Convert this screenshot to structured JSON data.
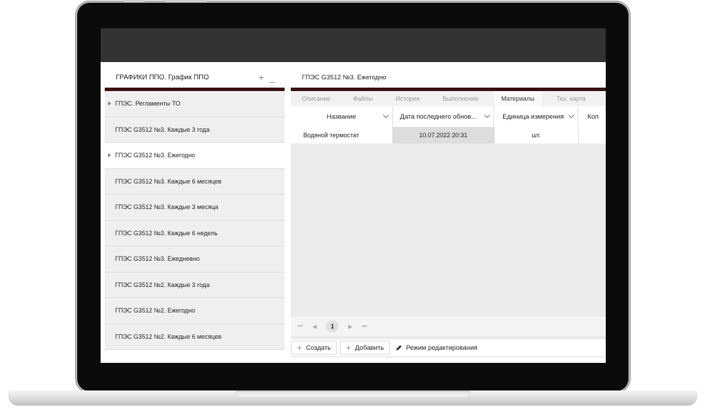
{
  "left_panel": {
    "title": "ГРАФИКИ ППО. График ППО",
    "add_symbol": "+",
    "minimize_symbol": "_",
    "items": [
      {
        "label": "ГПЭС. Регламенты ТО",
        "expandable": true,
        "selected": false
      },
      {
        "label": "ГПЭС G3512 №3. Каждые 3 года",
        "expandable": false,
        "selected": false
      },
      {
        "label": "ГПЭС G3512 №3. Ежегодно",
        "expandable": true,
        "selected": true
      },
      {
        "label": "ГПЭС G3512 №3. Каждые 6 месяцев",
        "expandable": false,
        "selected": false
      },
      {
        "label": "ГПЭС G3512 №3. Каждые 3 месяца",
        "expandable": false,
        "selected": false
      },
      {
        "label": "ГПЭС G3512 №3. Каждые 6 недель",
        "expandable": false,
        "selected": false
      },
      {
        "label": "ГПЭС G3512 №3. Ежедневно",
        "expandable": false,
        "selected": false
      },
      {
        "label": "ГПЭС G3512 №2. Каждые 3 года",
        "expandable": false,
        "selected": false
      },
      {
        "label": "ГПЭС G3512 №2. Ежегодно",
        "expandable": false,
        "selected": false
      },
      {
        "label": "ГПЭС G3512 №2. Каждые 6 месяцев",
        "expandable": false,
        "selected": false
      }
    ]
  },
  "right_panel": {
    "title": "ГПЭС G3512 №3. Ежегодно",
    "tabs": [
      {
        "label": "Описание",
        "active": false
      },
      {
        "label": "Файлы",
        "active": false
      },
      {
        "label": "История",
        "active": false
      },
      {
        "label": "Выполнение",
        "active": false
      },
      {
        "label": "Материалы",
        "active": true
      },
      {
        "label": "Тех. карта",
        "active": false
      }
    ],
    "table": {
      "columns": [
        "Название",
        "Дата последнего обнов...",
        "Единица измерения",
        "Кол"
      ],
      "rows": [
        {
          "name": "Водяной термостат",
          "date": "10.07.2022 20:31",
          "unit": "шт.",
          "qty": ""
        }
      ]
    },
    "pager": {
      "page": "1"
    },
    "actions": {
      "create": "Создать",
      "add": "Добавить",
      "edit_mode": "Режим редактирования"
    }
  },
  "colors": {
    "accent": "#3a0f0f",
    "topbar": "#333333",
    "selected_cell": "#dddddd"
  }
}
